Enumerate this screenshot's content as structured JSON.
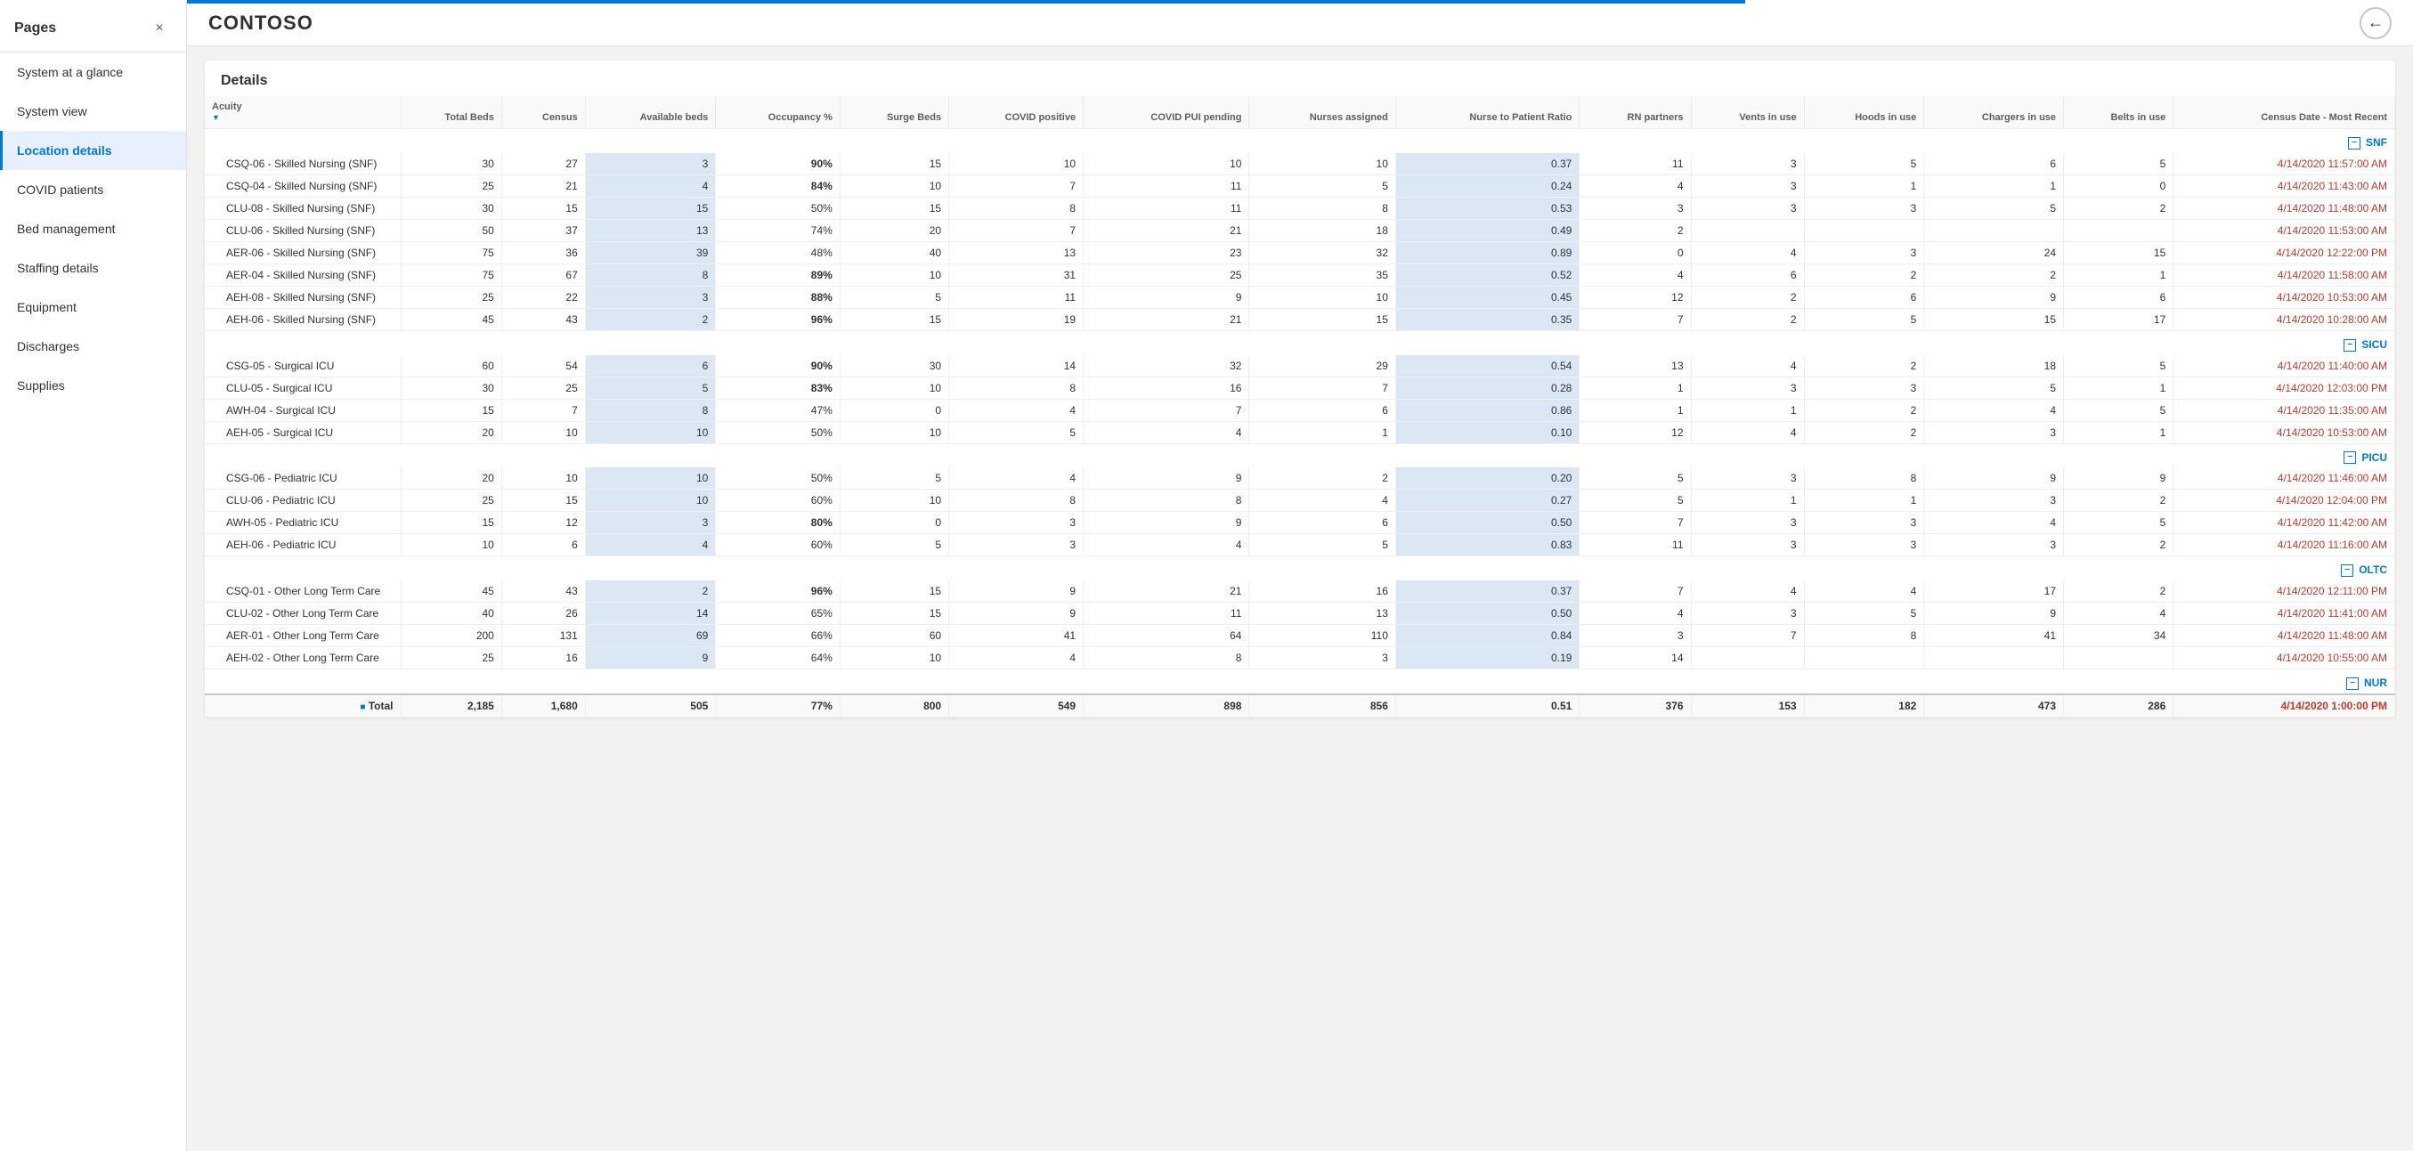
{
  "sidebar": {
    "header": "Pages",
    "close_label": "×",
    "items": [
      {
        "id": "system-at-a-glance",
        "label": "System at a glance",
        "active": false
      },
      {
        "id": "system-view",
        "label": "System view",
        "active": false
      },
      {
        "id": "location-details",
        "label": "Location details",
        "active": true
      },
      {
        "id": "covid-patients",
        "label": "COVID patients",
        "active": false
      },
      {
        "id": "bed-management",
        "label": "Bed management",
        "active": false
      },
      {
        "id": "staffing-details",
        "label": "Staffing details",
        "active": false
      },
      {
        "id": "equipment",
        "label": "Equipment",
        "active": false
      },
      {
        "id": "discharges",
        "label": "Discharges",
        "active": false
      },
      {
        "id": "supplies",
        "label": "Supplies",
        "active": false
      }
    ]
  },
  "topbar": {
    "title": "CONTOSO",
    "back_label": "←"
  },
  "details": {
    "title": "Details",
    "columns": [
      {
        "id": "acuity",
        "label": "Acuity",
        "type": "name"
      },
      {
        "id": "total_beds",
        "label": "Total Beds",
        "type": "num"
      },
      {
        "id": "census",
        "label": "Census",
        "type": "num"
      },
      {
        "id": "available_beds",
        "label": "Available beds",
        "type": "num"
      },
      {
        "id": "occupancy_pct",
        "label": "Occupancy %",
        "type": "num"
      },
      {
        "id": "surge_beds",
        "label": "Surge Beds",
        "type": "num"
      },
      {
        "id": "covid_positive",
        "label": "COVID positive",
        "type": "num"
      },
      {
        "id": "covid_pui_pending",
        "label": "COVID PUI pending",
        "type": "num"
      },
      {
        "id": "nurses_assigned",
        "label": "Nurses assigned",
        "type": "num"
      },
      {
        "id": "nurse_patient_ratio",
        "label": "Nurse to Patient Ratio",
        "type": "num"
      },
      {
        "id": "rn_partners",
        "label": "RN partners",
        "type": "num"
      },
      {
        "id": "vents_in_use",
        "label": "Vents in use",
        "type": "num"
      },
      {
        "id": "hoods_in_use",
        "label": "Hoods in use",
        "type": "num"
      },
      {
        "id": "chargers_in_use",
        "label": "Chargers in use",
        "type": "num"
      },
      {
        "id": "belts_in_use",
        "label": "Belts in use",
        "type": "num"
      },
      {
        "id": "census_date",
        "label": "Census Date - Most Recent",
        "type": "date"
      }
    ],
    "groups": [
      {
        "id": "SNF",
        "label": "SNF",
        "rows": [
          {
            "name": "CSQ-06 - Skilled Nursing (SNF)",
            "total_beds": 30,
            "census": 27,
            "available_beds": 3,
            "available_highlight": true,
            "occupancy_pct": "90%",
            "occupancy_red": true,
            "surge_beds": 15,
            "covid_positive": 10,
            "covid_pui_pending": 10,
            "nurses_assigned": 10,
            "nurse_patient_ratio": "0.37",
            "ratio_highlight": true,
            "rn_partners": 11,
            "vents_in_use": 3,
            "hoods_in_use": 5,
            "chargers_in_use": 6,
            "belts_in_use": 5,
            "census_date": "4/14/2020 11:57:00 AM",
            "date_red": true
          },
          {
            "name": "CSQ-04 - Skilled Nursing (SNF)",
            "total_beds": 25,
            "census": 21,
            "available_beds": 4,
            "available_highlight": true,
            "occupancy_pct": "84%",
            "occupancy_red": true,
            "surge_beds": 10,
            "covid_positive": 7,
            "covid_pui_pending": 11,
            "nurses_assigned": 5,
            "nurse_patient_ratio": "0.24",
            "ratio_highlight": true,
            "rn_partners": 4,
            "vents_in_use": 3,
            "hoods_in_use": 1,
            "chargers_in_use": 1,
            "belts_in_use": 0,
            "census_date": "4/14/2020 11:43:00 AM",
            "date_red": true
          },
          {
            "name": "CLU-08 - Skilled Nursing (SNF)",
            "total_beds": 30,
            "census": 15,
            "available_beds": 15,
            "available_highlight": true,
            "occupancy_pct": "50%",
            "occupancy_red": false,
            "surge_beds": 15,
            "covid_positive": 8,
            "covid_pui_pending": 11,
            "nurses_assigned": 8,
            "nurse_patient_ratio": "0.53",
            "ratio_highlight": true,
            "rn_partners": 3,
            "vents_in_use": 3,
            "hoods_in_use": 3,
            "chargers_in_use": 5,
            "belts_in_use": 2,
            "census_date": "4/14/2020 11:48:00 AM",
            "date_red": true
          },
          {
            "name": "CLU-06 - Skilled Nursing (SNF)",
            "total_beds": 50,
            "census": 37,
            "available_beds": 13,
            "available_highlight": true,
            "occupancy_pct": "74%",
            "occupancy_red": false,
            "surge_beds": 20,
            "covid_positive": 7,
            "covid_pui_pending": 21,
            "nurses_assigned": 18,
            "nurse_patient_ratio": "0.49",
            "ratio_highlight": true,
            "rn_partners": 2,
            "vents_in_use": "",
            "hoods_in_use": "",
            "chargers_in_use": "",
            "belts_in_use": "",
            "census_date": "4/14/2020 11:53:00 AM",
            "date_red": true
          },
          {
            "name": "AER-06 - Skilled Nursing (SNF)",
            "total_beds": 75,
            "census": 36,
            "available_beds": 39,
            "available_highlight": true,
            "occupancy_pct": "48%",
            "occupancy_red": false,
            "surge_beds": 40,
            "covid_positive": 13,
            "covid_pui_pending": 23,
            "nurses_assigned": 32,
            "nurse_patient_ratio": "0.89",
            "ratio_highlight": true,
            "rn_partners": 0,
            "vents_in_use": 4,
            "hoods_in_use": 3,
            "chargers_in_use": 24,
            "belts_in_use": 15,
            "census_date": "4/14/2020 12:22:00 PM",
            "date_red": true
          },
          {
            "name": "AER-04 - Skilled Nursing (SNF)",
            "total_beds": 75,
            "census": 67,
            "available_beds": 8,
            "available_highlight": true,
            "occupancy_pct": "89%",
            "occupancy_red": true,
            "surge_beds": 10,
            "covid_positive": 31,
            "covid_pui_pending": 25,
            "nurses_assigned": 35,
            "nurse_patient_ratio": "0.52",
            "ratio_highlight": true,
            "rn_partners": 4,
            "vents_in_use": 6,
            "hoods_in_use": 2,
            "chargers_in_use": 2,
            "belts_in_use": 1,
            "census_date": "4/14/2020 11:58:00 AM",
            "date_red": true
          },
          {
            "name": "AEH-08 - Skilled Nursing (SNF)",
            "total_beds": 25,
            "census": 22,
            "available_beds": 3,
            "available_highlight": true,
            "occupancy_pct": "88%",
            "occupancy_red": true,
            "surge_beds": 5,
            "covid_positive": 11,
            "covid_pui_pending": 9,
            "nurses_assigned": 10,
            "nurse_patient_ratio": "0.45",
            "ratio_highlight": true,
            "rn_partners": 12,
            "vents_in_use": 2,
            "hoods_in_use": 6,
            "chargers_in_use": 9,
            "belts_in_use": 6,
            "census_date": "4/14/2020 10:53:00 AM",
            "date_red": true
          },
          {
            "name": "AEH-06 - Skilled Nursing (SNF)",
            "total_beds": 45,
            "census": 43,
            "available_beds": 2,
            "available_highlight": true,
            "occupancy_pct": "96%",
            "occupancy_red": true,
            "surge_beds": 15,
            "covid_positive": 19,
            "covid_pui_pending": 21,
            "nurses_assigned": 15,
            "nurse_patient_ratio": "0.35",
            "ratio_highlight": true,
            "rn_partners": 7,
            "vents_in_use": 2,
            "hoods_in_use": 5,
            "chargers_in_use": 15,
            "belts_in_use": 17,
            "census_date": "4/14/2020 10:28:00 AM",
            "date_red": true
          }
        ]
      },
      {
        "id": "SICU",
        "label": "SICU",
        "rows": [
          {
            "name": "CSG-05 - Surgical ICU",
            "total_beds": 60,
            "census": 54,
            "available_beds": 6,
            "available_highlight": true,
            "occupancy_pct": "90%",
            "occupancy_red": true,
            "surge_beds": 30,
            "covid_positive": 14,
            "covid_pui_pending": 32,
            "nurses_assigned": 29,
            "nurse_patient_ratio": "0.54",
            "ratio_highlight": true,
            "rn_partners": 13,
            "vents_in_use": 4,
            "hoods_in_use": 2,
            "chargers_in_use": 18,
            "belts_in_use": 5,
            "census_date": "4/14/2020 11:40:00 AM",
            "date_red": true
          },
          {
            "name": "CLU-05 - Surgical ICU",
            "total_beds": 30,
            "census": 25,
            "available_beds": 5,
            "available_highlight": true,
            "occupancy_pct": "83%",
            "occupancy_red": true,
            "surge_beds": 10,
            "covid_positive": 8,
            "covid_pui_pending": 16,
            "nurses_assigned": 7,
            "nurse_patient_ratio": "0.28",
            "ratio_highlight": true,
            "rn_partners": 1,
            "vents_in_use": 3,
            "hoods_in_use": 3,
            "chargers_in_use": 5,
            "belts_in_use": 1,
            "census_date": "4/14/2020 12:03:00 PM",
            "date_red": true
          },
          {
            "name": "AWH-04 - Surgical ICU",
            "total_beds": 15,
            "census": 7,
            "available_beds": 8,
            "available_highlight": true,
            "occupancy_pct": "47%",
            "occupancy_red": false,
            "surge_beds": 0,
            "covid_positive": 4,
            "covid_pui_pending": 7,
            "nurses_assigned": 6,
            "nurse_patient_ratio": "0.86",
            "ratio_highlight": true,
            "rn_partners": 1,
            "vents_in_use": 1,
            "hoods_in_use": 2,
            "chargers_in_use": 4,
            "belts_in_use": 5,
            "census_date": "4/14/2020 11:35:00 AM",
            "date_red": true
          },
          {
            "name": "AEH-05 - Surgical ICU",
            "total_beds": 20,
            "census": 10,
            "available_beds": 10,
            "available_highlight": true,
            "occupancy_pct": "50%",
            "occupancy_red": false,
            "surge_beds": 10,
            "covid_positive": 5,
            "covid_pui_pending": 4,
            "nurses_assigned": 1,
            "nurse_patient_ratio": "0.10",
            "ratio_highlight": true,
            "rn_partners": 12,
            "vents_in_use": 4,
            "hoods_in_use": 2,
            "chargers_in_use": 3,
            "belts_in_use": 1,
            "census_date": "4/14/2020 10:53:00 AM",
            "date_red": true
          }
        ]
      },
      {
        "id": "PICU",
        "label": "PICU",
        "rows": [
          {
            "name": "CSG-06 - Pediatric ICU",
            "total_beds": 20,
            "census": 10,
            "available_beds": 10,
            "available_highlight": true,
            "occupancy_pct": "50%",
            "occupancy_red": false,
            "surge_beds": 5,
            "covid_positive": 4,
            "covid_pui_pending": 9,
            "nurses_assigned": 2,
            "nurse_patient_ratio": "0.20",
            "ratio_highlight": true,
            "rn_partners": 5,
            "vents_in_use": 3,
            "hoods_in_use": 8,
            "chargers_in_use": 9,
            "belts_in_use": 9,
            "census_date": "4/14/2020 11:46:00 AM",
            "date_red": true
          },
          {
            "name": "CLU-06 - Pediatric ICU",
            "total_beds": 25,
            "census": 15,
            "available_beds": 10,
            "available_highlight": true,
            "occupancy_pct": "60%",
            "occupancy_red": false,
            "surge_beds": 10,
            "covid_positive": 8,
            "covid_pui_pending": 8,
            "nurses_assigned": 4,
            "nurse_patient_ratio": "0.27",
            "ratio_highlight": true,
            "rn_partners": 5,
            "vents_in_use": 1,
            "hoods_in_use": 1,
            "chargers_in_use": 3,
            "belts_in_use": 2,
            "census_date": "4/14/2020 12:04:00 PM",
            "date_red": true
          },
          {
            "name": "AWH-05 - Pediatric ICU",
            "total_beds": 15,
            "census": 12,
            "available_beds": 3,
            "available_highlight": true,
            "occupancy_pct": "80%",
            "occupancy_red": true,
            "surge_beds": 0,
            "covid_positive": 3,
            "covid_pui_pending": 9,
            "nurses_assigned": 6,
            "nurse_patient_ratio": "0.50",
            "ratio_highlight": true,
            "rn_partners": 7,
            "vents_in_use": 3,
            "hoods_in_use": 3,
            "chargers_in_use": 4,
            "belts_in_use": 5,
            "census_date": "4/14/2020 11:42:00 AM",
            "date_red": true
          },
          {
            "name": "AEH-06 - Pediatric ICU",
            "total_beds": 10,
            "census": 6,
            "available_beds": 4,
            "available_highlight": true,
            "occupancy_pct": "60%",
            "occupancy_red": false,
            "surge_beds": 5,
            "covid_positive": 3,
            "covid_pui_pending": 4,
            "nurses_assigned": 5,
            "nurse_patient_ratio": "0.83",
            "ratio_highlight": true,
            "rn_partners": 11,
            "vents_in_use": 3,
            "hoods_in_use": 3,
            "chargers_in_use": 3,
            "belts_in_use": 2,
            "census_date": "4/14/2020 11:16:00 AM",
            "date_red": true
          }
        ]
      },
      {
        "id": "OLTC",
        "label": "OLTC",
        "rows": [
          {
            "name": "CSQ-01 - Other Long Term Care",
            "total_beds": 45,
            "census": 43,
            "available_beds": 2,
            "available_highlight": true,
            "occupancy_pct": "96%",
            "occupancy_red": true,
            "surge_beds": 15,
            "covid_positive": 9,
            "covid_pui_pending": 21,
            "nurses_assigned": 16,
            "nurse_patient_ratio": "0.37",
            "ratio_highlight": true,
            "rn_partners": 7,
            "vents_in_use": 4,
            "hoods_in_use": 4,
            "chargers_in_use": 17,
            "belts_in_use": 2,
            "census_date": "4/14/2020 12:11:00 PM",
            "date_red": true
          },
          {
            "name": "CLU-02 - Other Long Term Care",
            "total_beds": 40,
            "census": 26,
            "available_beds": 14,
            "available_highlight": true,
            "occupancy_pct": "65%",
            "occupancy_red": false,
            "surge_beds": 15,
            "covid_positive": 9,
            "covid_pui_pending": 11,
            "nurses_assigned": 13,
            "nurse_patient_ratio": "0.50",
            "ratio_highlight": true,
            "rn_partners": 4,
            "vents_in_use": 3,
            "hoods_in_use": 5,
            "chargers_in_use": 9,
            "belts_in_use": 4,
            "census_date": "4/14/2020 11:41:00 AM",
            "date_red": true
          },
          {
            "name": "AER-01 - Other Long Term Care",
            "total_beds": 200,
            "census": 131,
            "available_beds": 69,
            "available_highlight": true,
            "occupancy_pct": "66%",
            "occupancy_red": false,
            "surge_beds": 60,
            "covid_positive": 41,
            "covid_pui_pending": 64,
            "nurses_assigned": 110,
            "nurse_patient_ratio": "0.84",
            "ratio_highlight": true,
            "rn_partners": 3,
            "vents_in_use": 7,
            "hoods_in_use": 8,
            "chargers_in_use": 41,
            "belts_in_use": 34,
            "census_date": "4/14/2020 11:48:00 AM",
            "date_red": true
          },
          {
            "name": "AEH-02 - Other Long Term Care",
            "total_beds": 25,
            "census": 16,
            "available_beds": 9,
            "available_highlight": true,
            "occupancy_pct": "64%",
            "occupancy_red": false,
            "surge_beds": 10,
            "covid_positive": 4,
            "covid_pui_pending": 8,
            "nurses_assigned": 3,
            "nurse_patient_ratio": "0.19",
            "ratio_highlight": true,
            "rn_partners": 14,
            "vents_in_use": "",
            "hoods_in_use": "",
            "chargers_in_use": "",
            "belts_in_use": "",
            "census_date": "4/14/2020 10:55:00 AM",
            "date_red": true
          }
        ]
      },
      {
        "id": "NUR",
        "label": "NUR",
        "rows": []
      }
    ],
    "totals": {
      "label": "Total",
      "total_beds": "2,185",
      "census": "1,680",
      "available_beds": "505",
      "occupancy_pct": "77%",
      "surge_beds": "800",
      "covid_positive": "549",
      "covid_pui_pending": "898",
      "nurses_assigned": "856",
      "nurse_patient_ratio": "0.51",
      "rn_partners": "376",
      "vents_in_use": "153",
      "hoods_in_use": "182",
      "chargers_in_use": "473",
      "belts_in_use": "286",
      "census_date": "4/14/2020 1:00:00 PM"
    }
  }
}
